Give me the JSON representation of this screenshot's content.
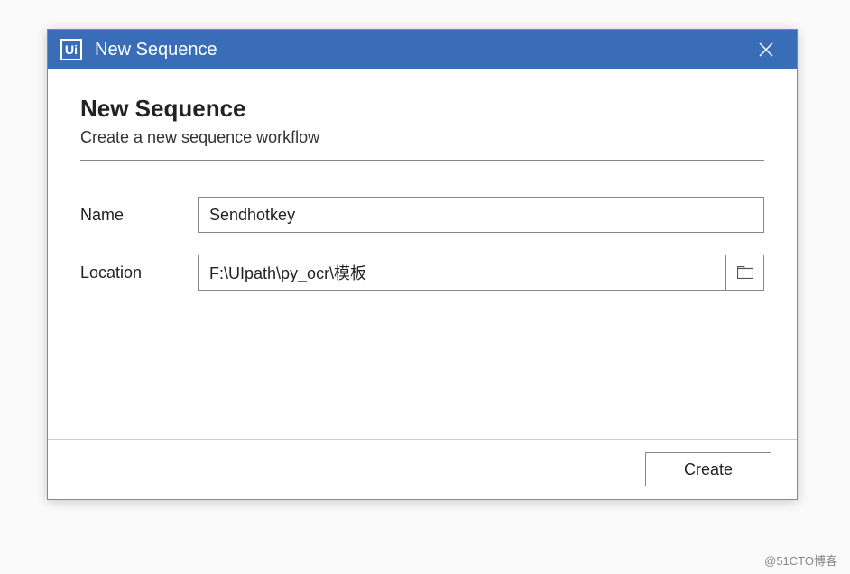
{
  "titlebar": {
    "icon_text": "Ui",
    "title": "New Sequence"
  },
  "dialog": {
    "heading": "New Sequence",
    "subheading": "Create a new sequence workflow"
  },
  "form": {
    "name_label": "Name",
    "name_value": "Sendhotkey",
    "location_label": "Location",
    "location_value": "F:\\UIpath\\py_ocr\\模板"
  },
  "footer": {
    "create_label": "Create"
  },
  "watermark": "@51CTO博客"
}
